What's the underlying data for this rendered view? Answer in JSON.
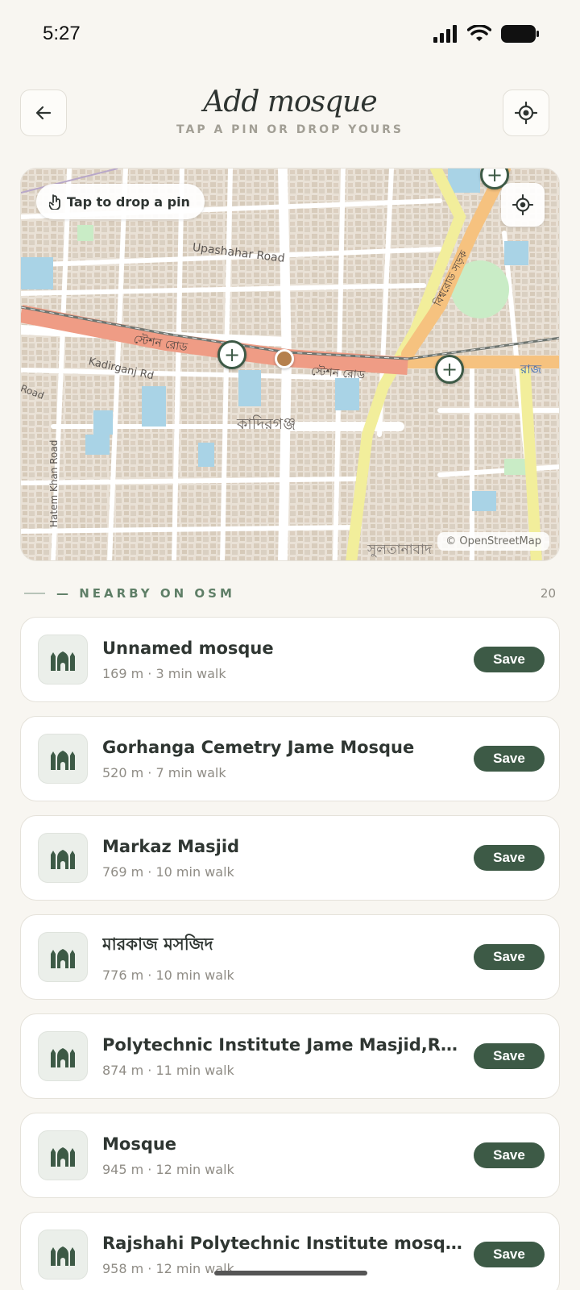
{
  "status_bar": {
    "time": "5:27"
  },
  "header": {
    "title": "Add mosque",
    "subtitle": "TAP A PIN OR DROP YOURS"
  },
  "map": {
    "hint": "Tap to drop a pin",
    "attribution": "© OpenStreetMap",
    "labels": {
      "upashahar": "Upashahar Road",
      "station_left": "স্টেশন রোড",
      "station_right": "স্টেশন রোড",
      "kadirganj_rd": "Kadirganj Rd",
      "kadirganj": "কাদিরগঞ্জ",
      "hatem": "Hatem Khan Road",
      "road_left": "Road",
      "bishwa": "বিশ্বরোড সড়ক",
      "raj": "রাজ",
      "sultana": "সুলতানাবাদ"
    }
  },
  "nearby": {
    "title": "— NEARBY ON OSM",
    "count": "20",
    "items": [
      {
        "name": "Unnamed mosque",
        "meta": "169 m · 3 min walk",
        "action": "Save"
      },
      {
        "name": "Gorhanga Cemetry Jame Mosque",
        "meta": "520 m · 7 min walk",
        "action": "Save"
      },
      {
        "name": "Markaz Masjid",
        "meta": "769 m · 10 min walk",
        "action": "Save"
      },
      {
        "name": "মারকাজ মসজিদ",
        "meta": "776 m · 10 min walk",
        "action": "Save"
      },
      {
        "name": "Polytechnic Institute Jame Masjid,Rajshahi",
        "meta": "874 m · 11 min walk",
        "action": "Save"
      },
      {
        "name": "Mosque",
        "meta": "945 m · 12 min walk",
        "action": "Save"
      },
      {
        "name": "Rajshahi Polytechnic Institute mosque",
        "meta": "958 m · 12 min walk",
        "action": "Save"
      }
    ]
  }
}
